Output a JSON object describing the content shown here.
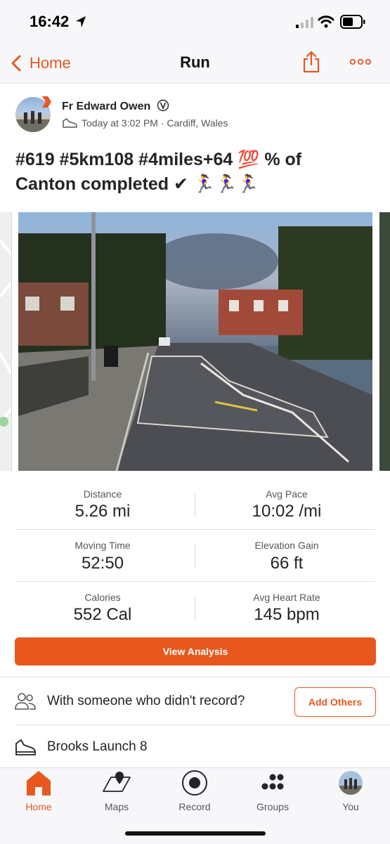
{
  "status_bar": {
    "time": "16:42"
  },
  "nav": {
    "back_label": "Home",
    "title": "Run"
  },
  "activity": {
    "athlete": "Fr Edward Owen",
    "meta": "Today at 3:02 PM · Cardiff, Wales",
    "title_line1": "#619 #5km108 #4miles+64 💯 % of",
    "title_line2": "Canton completed ✔ 🏃‍♀️🏃‍♀️🏃‍♀️"
  },
  "stats": [
    {
      "label": "Distance",
      "value": "5.26 mi"
    },
    {
      "label": "Avg Pace",
      "value": "10:02 /mi"
    },
    {
      "label": "Moving Time",
      "value": "52:50"
    },
    {
      "label": "Elevation Gain",
      "value": "66 ft"
    },
    {
      "label": "Calories",
      "value": "552 Cal"
    },
    {
      "label": "Avg Heart Rate",
      "value": "145 bpm"
    }
  ],
  "actions": {
    "view_analysis": "View Analysis",
    "with_someone": "With someone who didn't record?",
    "add_others": "Add Others",
    "gear": "Brooks Launch 8"
  },
  "tabs": [
    {
      "label": "Home",
      "icon": "home-icon",
      "active": true
    },
    {
      "label": "Maps",
      "icon": "maps-icon"
    },
    {
      "label": "Record",
      "icon": "record-icon"
    },
    {
      "label": "Groups",
      "icon": "groups-icon"
    },
    {
      "label": "You",
      "icon": "avatar-icon"
    }
  ],
  "colors": {
    "accent": "#e8581e",
    "text": "#242428",
    "muted": "#55565c"
  }
}
